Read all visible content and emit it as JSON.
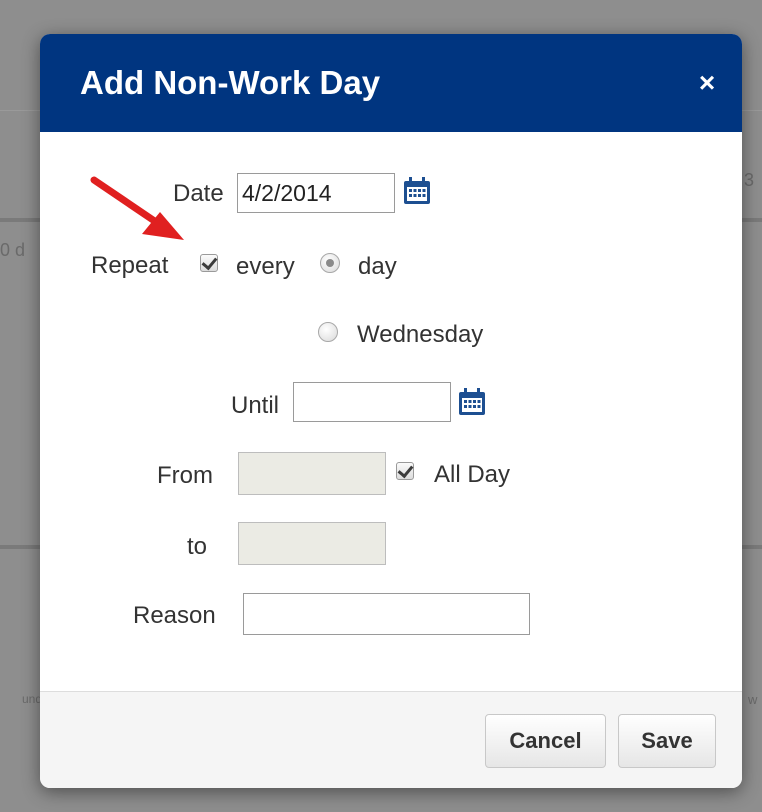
{
  "dialog": {
    "title": "Add Non-Work Day",
    "close_label": "×"
  },
  "form": {
    "date_label": "Date",
    "date_value": "4/2/2014",
    "repeat_label": "Repeat",
    "repeat_checked": true,
    "every_label": "every",
    "day_option_label": "day",
    "day_option_selected": true,
    "weekday_option_label": "Wednesday",
    "weekday_option_selected": false,
    "until_label": "Until",
    "until_value": "",
    "from_label": "From",
    "from_value": "",
    "all_day_label": "All Day",
    "all_day_checked": true,
    "to_label": "to",
    "to_value": "",
    "reason_label": "Reason",
    "reason_value": ""
  },
  "footer": {
    "cancel_label": "Cancel",
    "save_label": "Save"
  },
  "background": {
    "fragment_left": "0 d",
    "fragment_right": "3",
    "fragment_bottom_left": "und",
    "fragment_bottom_right": "w"
  },
  "icons": {
    "calendar": "calendar-icon",
    "close": "close-icon",
    "annotation": "red-arrow-annotation"
  },
  "colors": {
    "header": "#003580",
    "arrow": "#e02020",
    "calendar_icon": "#1d4f91"
  }
}
